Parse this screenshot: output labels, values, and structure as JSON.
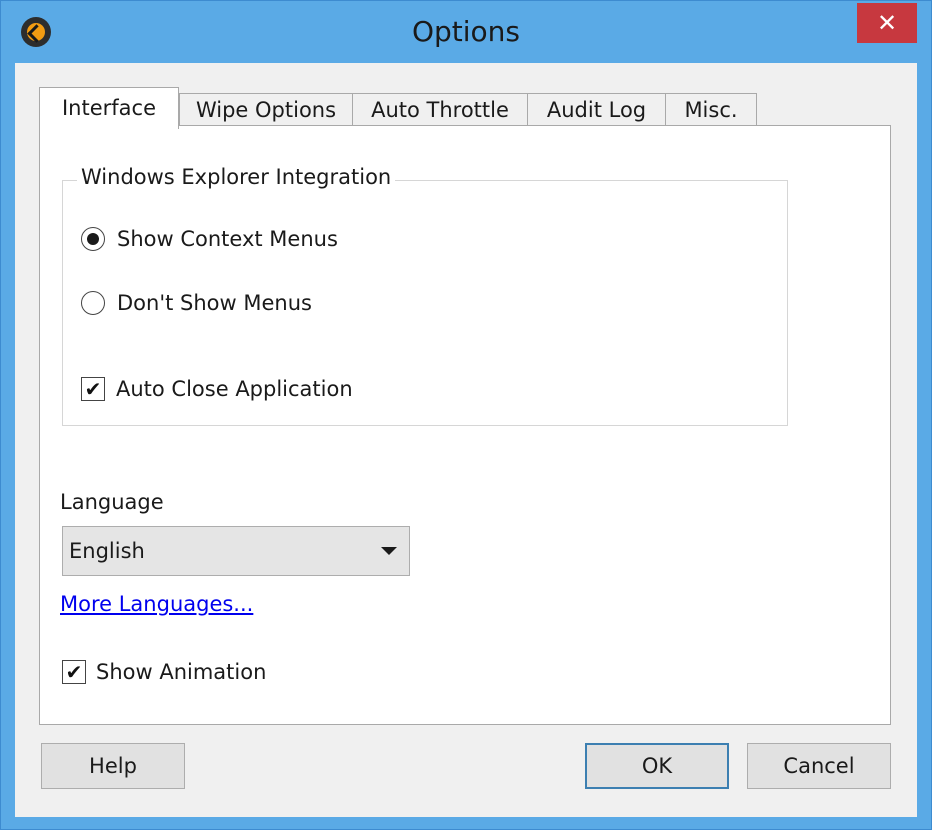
{
  "window": {
    "title": "Options",
    "close_glyph": "✕",
    "app_icon": "app-logo-icon"
  },
  "tabs": [
    {
      "label": "Interface",
      "active": true
    },
    {
      "label": "Wipe Options",
      "active": false
    },
    {
      "label": "Auto Throttle",
      "active": false
    },
    {
      "label": "Audit Log",
      "active": false
    },
    {
      "label": "Misc.",
      "active": false
    }
  ],
  "explorer_group": {
    "title": "Windows Explorer Integration",
    "show_context_menus": {
      "label": "Show Context Menus",
      "selected": true
    },
    "dont_show_menus": {
      "label": "Don't Show Menus",
      "selected": false
    },
    "auto_close": {
      "label": "Auto Close Application",
      "checked": true
    }
  },
  "language": {
    "label": "Language",
    "selected": "English",
    "more_link": "More Languages..."
  },
  "show_animation": {
    "label": "Show Animation",
    "checked": true
  },
  "buttons": {
    "help": "Help",
    "ok": "OK",
    "cancel": "Cancel"
  },
  "colors": {
    "titlebar": "#5aaae6",
    "close": "#c7383f",
    "link": "#0000ee",
    "default_button_border": "#3c7fb1"
  }
}
